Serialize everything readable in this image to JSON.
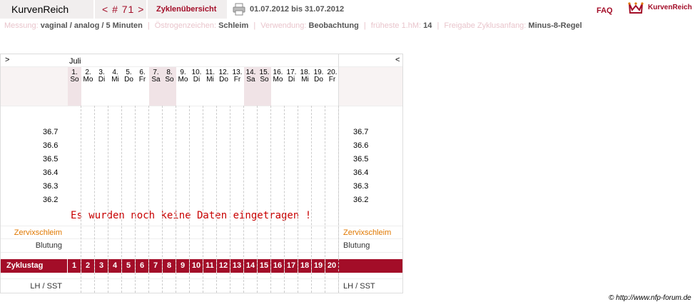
{
  "header": {
    "brand": "KurvenReich",
    "cycle_nav": "< # 71 >",
    "overview_tab": "Zyklenübersicht",
    "date_range": "01.07.2012 bis 31.07.2012",
    "faq": "FAQ",
    "logo_text": "KurvenReich"
  },
  "info": {
    "measurement_label": "Messung:",
    "measurement_value": "vaginal / analog / 5 Minuten",
    "estrogen_label": "Östrogenzeichen:",
    "estrogen_value": "Schleim",
    "usage_label": "Verwendung:",
    "usage_value": "Beobachtung",
    "earliest_label": "früheste 1.hM:",
    "earliest_value": "14",
    "release_label": "Freigabe Zyklusanfang:",
    "release_value": "Minus-8-Regel"
  },
  "chart": {
    "nav_prev": ">",
    "nav_next": "<",
    "month": "Juli",
    "days": [
      {
        "n": "1.",
        "d": "So",
        "weekend": true
      },
      {
        "n": "2.",
        "d": "Mo",
        "weekend": false
      },
      {
        "n": "3.",
        "d": "Di",
        "weekend": false
      },
      {
        "n": "4.",
        "d": "Mi",
        "weekend": false
      },
      {
        "n": "5.",
        "d": "Do",
        "weekend": false
      },
      {
        "n": "6.",
        "d": "Fr",
        "weekend": false
      },
      {
        "n": "7.",
        "d": "Sa",
        "weekend": true
      },
      {
        "n": "8.",
        "d": "So",
        "weekend": true
      },
      {
        "n": "9.",
        "d": "Mo",
        "weekend": false
      },
      {
        "n": "10.",
        "d": "Di",
        "weekend": false
      },
      {
        "n": "11.",
        "d": "Mi",
        "weekend": false
      },
      {
        "n": "12.",
        "d": "Do",
        "weekend": false
      },
      {
        "n": "13.",
        "d": "Fr",
        "weekend": false
      },
      {
        "n": "14.",
        "d": "Sa",
        "weekend": true
      },
      {
        "n": "15.",
        "d": "So",
        "weekend": true
      },
      {
        "n": "16.",
        "d": "Mo",
        "weekend": false
      },
      {
        "n": "17.",
        "d": "Di",
        "weekend": false
      },
      {
        "n": "18.",
        "d": "Mi",
        "weekend": false
      },
      {
        "n": "19.",
        "d": "Do",
        "weekend": false
      },
      {
        "n": "20.",
        "d": "Fr",
        "weekend": false
      }
    ],
    "temperatures": [
      "36.7",
      "36.6",
      "36.5",
      "36.4",
      "36.3",
      "36.2"
    ],
    "no_data_message": "Es wurden noch keine Daten eingetragen !",
    "cervix_label": "Zervixschleim",
    "bleeding_label": "Blutung",
    "cycle_day_label": "Zyklustag",
    "cycle_days": [
      "1",
      "2",
      "3",
      "4",
      "5",
      "6",
      "7",
      "8",
      "9",
      "10",
      "11",
      "12",
      "13",
      "14",
      "15",
      "16",
      "17",
      "18",
      "19",
      "20"
    ],
    "lh_label": "LH / SST"
  },
  "footer": {
    "copyright": "© http://www.nfp-forum.de"
  },
  "colors": {
    "accent": "#a30d28",
    "weekend": "#f0e3e6",
    "cervix": "#e07800",
    "no_data": "#c80000"
  }
}
